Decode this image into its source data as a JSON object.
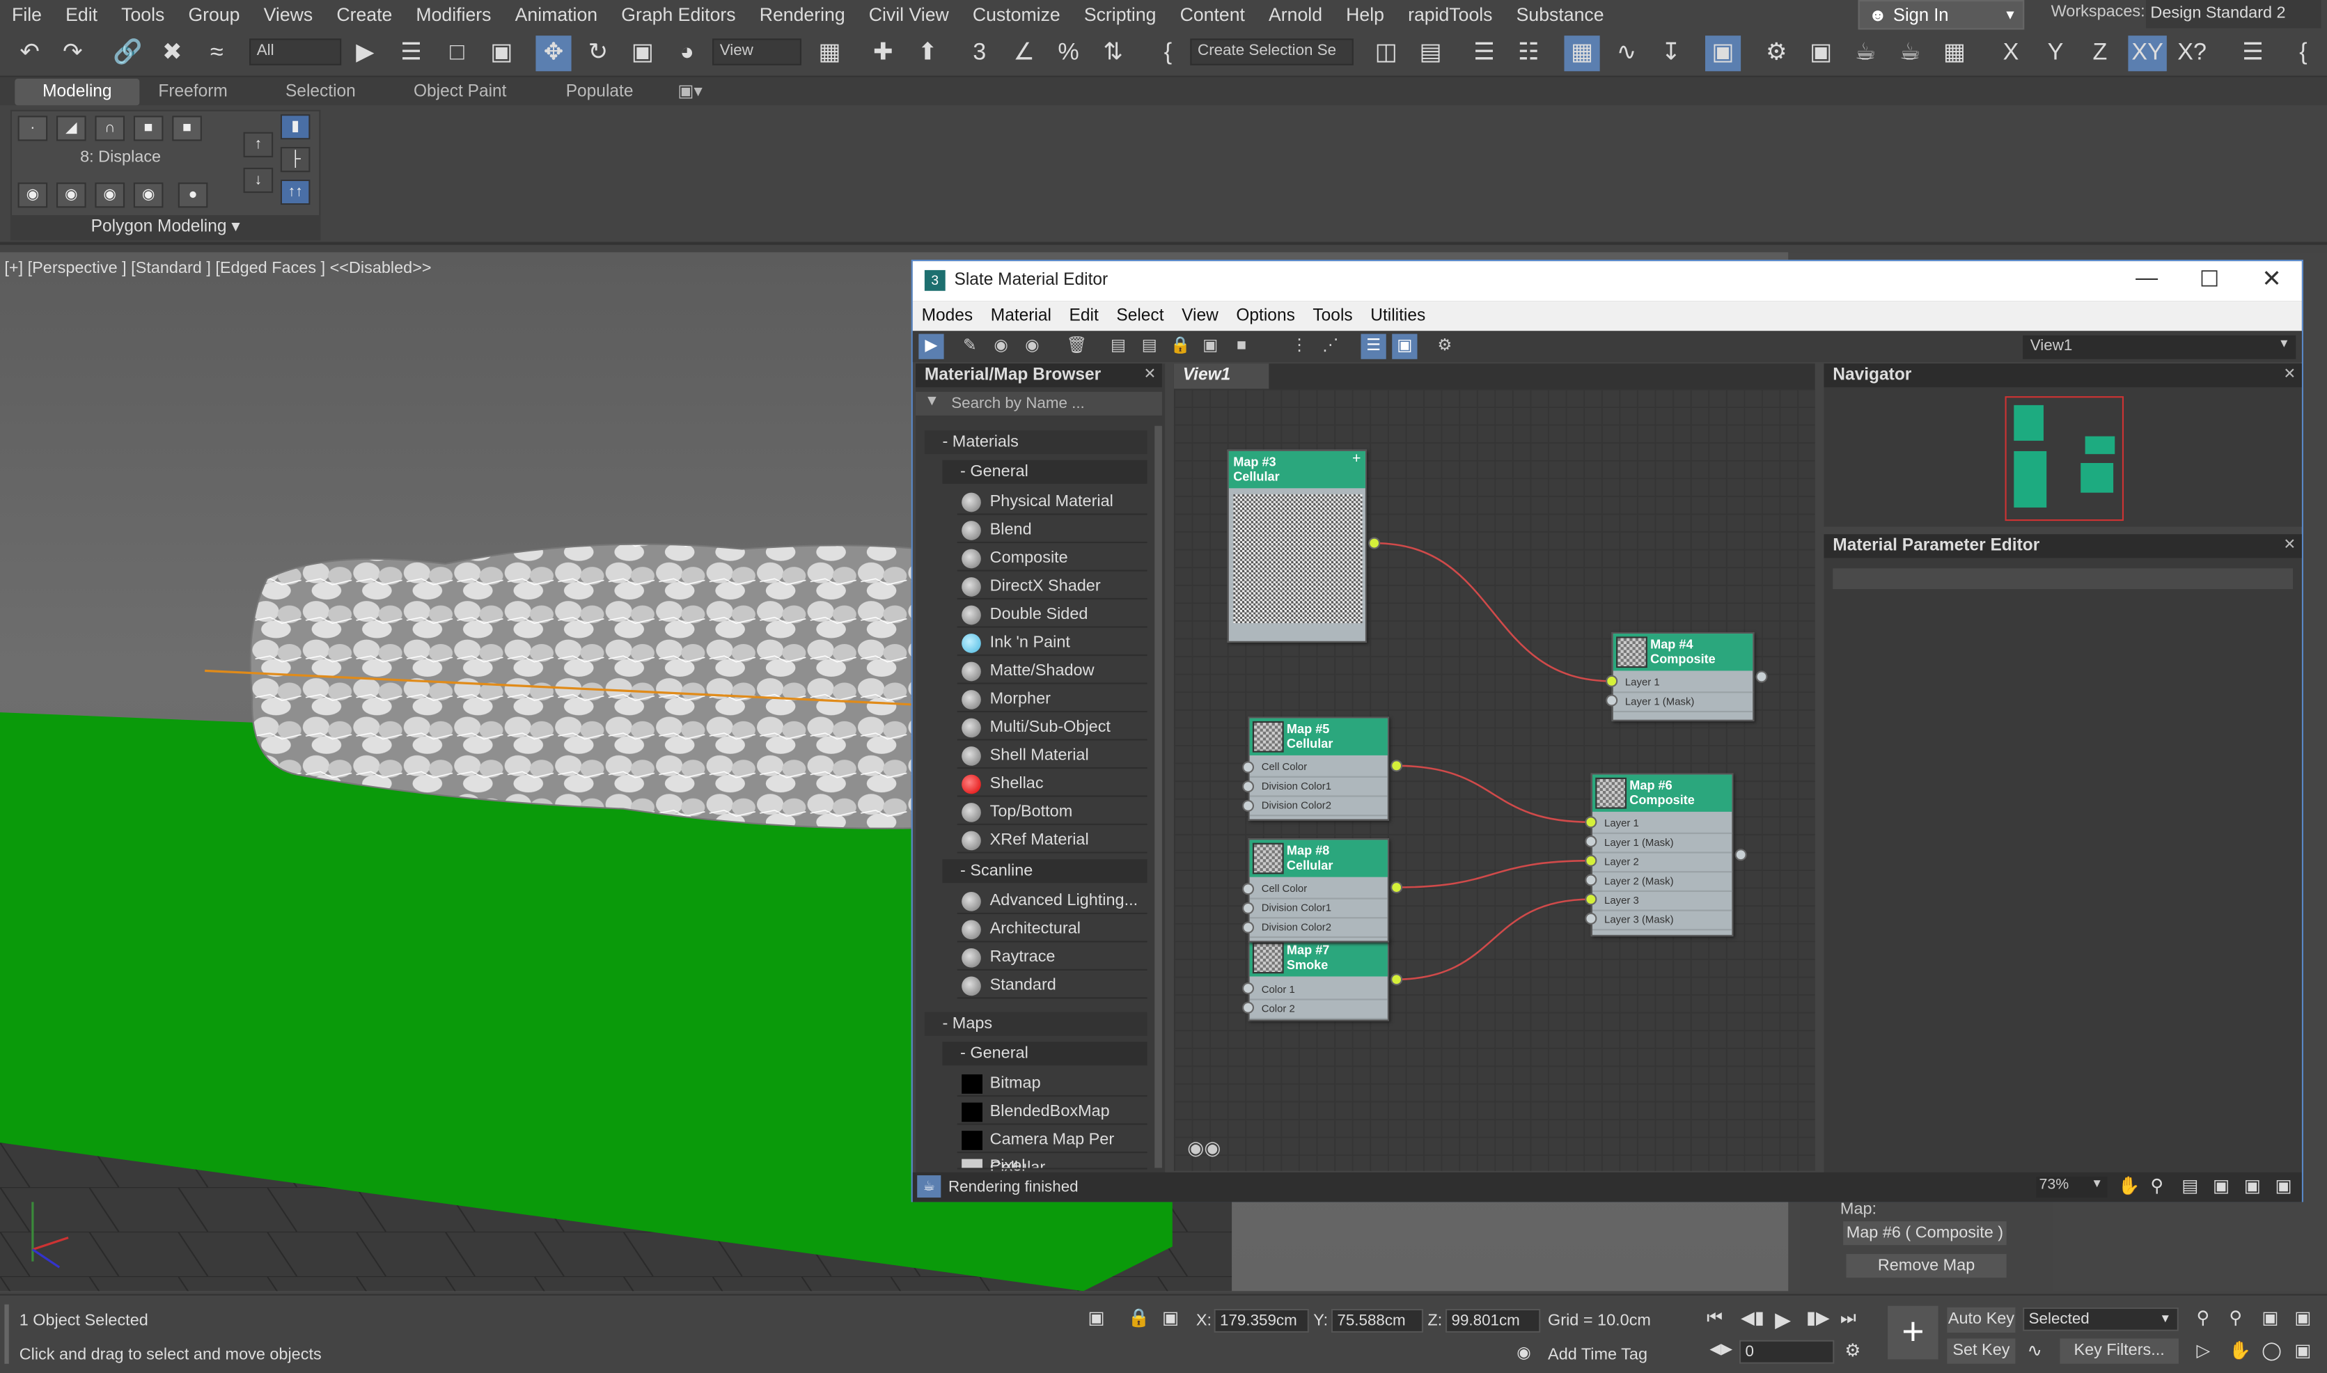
{
  "menubar": {
    "items": [
      "File",
      "Edit",
      "Tools",
      "Group",
      "Views",
      "Create",
      "Modifiers",
      "Animation",
      "Graph Editors",
      "Rendering",
      "Civil View",
      "Customize",
      "Scripting",
      "Content",
      "Arnold",
      "Help",
      "rapidTools",
      "Substance"
    ],
    "sign_in": "Sign In",
    "workspaces_label": "Workspaces:",
    "workspace_value": "Design Standard 2"
  },
  "toolbar": {
    "filter": "All",
    "view": "View",
    "selection_set": "Create Selection Se",
    "axis_x": "X",
    "axis_y": "Y",
    "axis_z": "Z",
    "axis_xy": "XY",
    "axis_xq": "X?"
  },
  "ribbon": {
    "tabs": [
      "Modeling",
      "Freeform",
      "Selection",
      "Object Paint",
      "Populate"
    ],
    "active_tab": "Modeling",
    "displace_label": "8: Displace",
    "poly_modeling": "Polygon Modeling"
  },
  "viewport": {
    "label": "[+] [Perspective ] [Standard ] [Edged Faces ]  <<Disabled>>"
  },
  "slate": {
    "title": "Slate Material Editor",
    "app_badge": "3",
    "menu": [
      "Modes",
      "Material",
      "Edit",
      "Select",
      "View",
      "Options",
      "Tools",
      "Utilities"
    ],
    "view_dropdown": "View1",
    "view_tab": "View1",
    "status": "Rendering finished",
    "zoom": "73%",
    "browser": {
      "title": "Material/Map Browser",
      "search_placeholder": "Search by Name ...",
      "materials": "Materials",
      "maps": "Maps",
      "general": "General",
      "scanline": "Scanline",
      "general_items": [
        "Physical Material",
        "Blend",
        "Composite",
        "DirectX Shader",
        "Double Sided",
        "Ink 'n Paint",
        "Matte/Shadow",
        "Morpher",
        "Multi/Sub-Object",
        "Shell Material",
        "Shellac",
        "Top/Bottom",
        "XRef Material"
      ],
      "scanline_items": [
        "Advanced Lighting...",
        "Architectural",
        "Raytrace",
        "Standard"
      ],
      "map_items": [
        "Bitmap",
        "BlendedBoxMap",
        "Camera Map Per Pixel",
        "Cellular"
      ]
    },
    "navigator": "Navigator",
    "param_editor": "Material Parameter Editor",
    "nodes": {
      "n3": {
        "title": "Map #3",
        "type": "Cellular"
      },
      "n4": {
        "title": "Map #4",
        "type": "Composite",
        "slots": [
          "Layer 1",
          "Layer 1 (Mask)"
        ]
      },
      "n5": {
        "title": "Map #5",
        "type": "Cellular",
        "slots": [
          "Cell Color",
          "Division Color1",
          "Division Color2"
        ]
      },
      "n8": {
        "title": "Map #8",
        "type": "Cellular",
        "slots": [
          "Cell Color",
          "Division Color1",
          "Division Color2"
        ]
      },
      "n7": {
        "title": "Map #7",
        "type": "Smoke",
        "slots": [
          "Color 1",
          "Color 2"
        ]
      },
      "n6": {
        "title": "Map #6",
        "type": "Composite",
        "slots": [
          "Layer 1",
          "Layer 1 (Mask)",
          "Layer 2",
          "Layer 2 (Mask)",
          "Layer 3",
          "Layer 3 (Mask)"
        ]
      }
    }
  },
  "map_panel": {
    "label": "Map:",
    "map_name": "Map #6  ( Composite )",
    "remove": "Remove Map"
  },
  "statusbar": {
    "selected": "1 Object Selected",
    "hint": "Click and drag to select and move objects",
    "x_label": "X:",
    "x_val": "179.359cm",
    "y_label": "Y:",
    "y_val": "75.588cm",
    "z_label": "Z:",
    "z_val": "99.801cm",
    "grid": "Grid = 10.0cm",
    "add_time_tag": "Add Time Tag",
    "auto_key": "Auto Key",
    "set_key": "Set Key",
    "selected_dd": "Selected",
    "key_filters": "Key Filters...",
    "frame": "0"
  },
  "colors": {
    "ground": "#0a9a0a",
    "node_header": "#2ba77d",
    "socket": "#d5f03a",
    "wire": "#d04a4a"
  }
}
